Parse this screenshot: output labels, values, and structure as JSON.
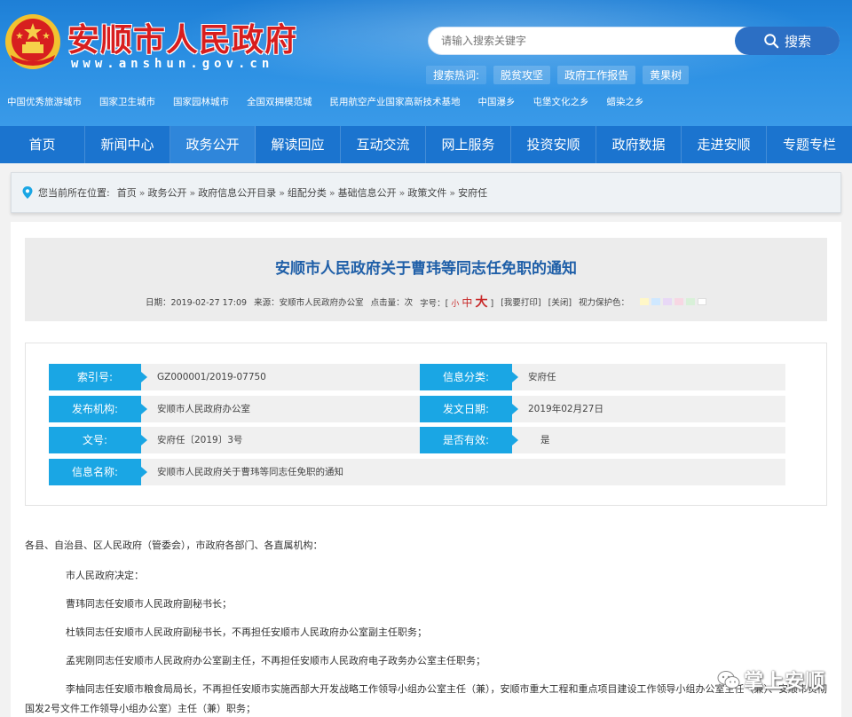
{
  "header": {
    "site_title": "安顺市人民政府",
    "site_url": "www.anshun.gov.cn",
    "search_placeholder": "请输入搜索关键字",
    "search_button": "搜索",
    "hot_label": "搜索热词:",
    "hot_items": [
      "脱贫攻坚",
      "政府工作报告",
      "黄果树"
    ],
    "honors": [
      "中国优秀旅游城市",
      "国家卫生城市",
      "国家园林城市",
      "全国双拥模范城",
      "民用航空产业国家高新技术基地",
      "中国瀑乡",
      "屯堡文化之乡",
      "蜡染之乡"
    ]
  },
  "nav": [
    "首页",
    "新闻中心",
    "政务公开",
    "解读回应",
    "互动交流",
    "网上服务",
    "投资安顺",
    "政府数据",
    "走进安顺",
    "专题专栏"
  ],
  "breadcrumb": {
    "prefix": "您当前所在位置:",
    "items": [
      "首页",
      "政务公开",
      "政府信息公开目录",
      "组配分类",
      "基础信息公开",
      "政策文件",
      "安府任"
    ]
  },
  "document": {
    "title": "安顺市人民政府关于曹玮等同志任免职的通知",
    "meta": {
      "date": "日期：2019-02-27 17:09",
      "source": "来源：安顺市人民政府办公室",
      "clicks": "点击量：次",
      "font_label": "字号：[",
      "font_small": "小",
      "font_mid": "中",
      "font_big": "大",
      "font_end": "]",
      "print": "[我要打印]",
      "close": "[关闭]",
      "eye": "视力保护色："
    },
    "swatch_colors": [
      "#fff7c7",
      "#cfe8ff",
      "#e8d8f6",
      "#f7d7e3",
      "#d8f0d8",
      "#ffffff"
    ],
    "info": {
      "index_label": "索引号:",
      "index_value": "GZ000001/2019-07750",
      "cat_label": "信息分类:",
      "cat_value": "安府任",
      "org_label": "发布机构:",
      "org_value": "安顺市人民政府办公室",
      "date_label": "发文日期:",
      "date_value": "2019年02月27日",
      "num_label": "文号:",
      "num_value": "安府任〔2019〕3号",
      "valid_label": "是否有效:",
      "valid_value": "是",
      "name_label": "信息名称:",
      "name_value": "安顺市人民政府关于曹玮等同志任免职的通知"
    },
    "paragraphs": [
      "各县、自治县、区人民政府（管委会），市政府各部门、各直属机构：",
      "市人民政府决定：",
      "曹玮同志任安顺市人民政府副秘书长；",
      "杜轶同志任安顺市人民政府副秘书长，不再担任安顺市人民政府办公室副主任职务；",
      "孟宪刚同志任安顺市人民政府办公室副主任，不再担任安顺市人民政府电子政务办公室主任职务；",
      "李柚同志任安顺市粮食局局长，不再担任安顺市实施西部大开发战略工作领导小组办公室主任（兼），安顺市重大工程和重点项目建设工作领导小组办公室主任（兼）、安顺市贯彻落实",
      "国发2号文件工作领导小组办公室）主任（兼）职务；"
    ]
  },
  "watermark": "掌上安顺"
}
